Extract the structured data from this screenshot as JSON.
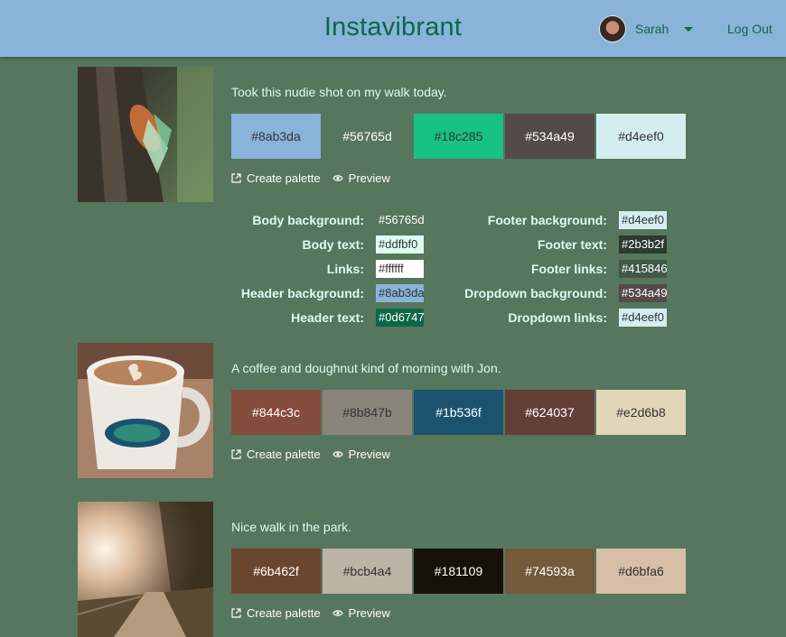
{
  "header": {
    "brand": "Instavibrant",
    "user_name": "Sarah",
    "logout_label": "Log Out",
    "background": "#8ab3da",
    "text_color": "#0d6747"
  },
  "actions": {
    "create_label": "Create palette",
    "preview_label": "Preview"
  },
  "posts": [
    {
      "caption": "Took this nudie shot on my walk today.",
      "photo": "cicada on tree bark",
      "swatches": [
        {
          "hex": "#8ab3da",
          "text": "#333333"
        },
        {
          "hex": "#56765d",
          "text": "#ffffff"
        },
        {
          "hex": "#18c285",
          "text": "#333333"
        },
        {
          "hex": "#534a49",
          "text": "#ffffff"
        },
        {
          "hex": "#d4eef0",
          "text": "#333333"
        }
      ],
      "mapping_left": [
        {
          "label": "Body background:",
          "value": "#56765d",
          "bg": "transparent",
          "fg": "#ffffff"
        },
        {
          "label": "Body text:",
          "value": "#ddfbf0",
          "bg": "#ddfbf0",
          "fg": "#333333"
        },
        {
          "label": "Links:",
          "value": "#ffffff",
          "bg": "#ffffff",
          "fg": "#333333"
        },
        {
          "label": "Header background:",
          "value": "#8ab3da",
          "bg": "#8ab3da",
          "fg": "#333333"
        },
        {
          "label": "Header text:",
          "value": "#0d6747",
          "bg": "#0d6747",
          "fg": "#ffffff"
        }
      ],
      "mapping_right": [
        {
          "label": "Footer background:",
          "value": "#d4eef0",
          "bg": "#d4eef0",
          "fg": "#333333"
        },
        {
          "label": "Footer text:",
          "value": "#2b3b2f",
          "bg": "#2b3b2f",
          "fg": "#ffffff"
        },
        {
          "label": "Footer links:",
          "value": "#415846",
          "bg": "#415846",
          "fg": "#ffffff"
        },
        {
          "label": "Dropdown background:",
          "value": "#534a49",
          "bg": "#534a49",
          "fg": "#ffffff"
        },
        {
          "label": "Dropdown links:",
          "value": "#d4eef0",
          "bg": "#d4eef0",
          "fg": "#333333"
        }
      ]
    },
    {
      "caption": "A coffee and doughnut kind of morning with Jon.",
      "photo": "latte in a mug",
      "swatches": [
        {
          "hex": "#844c3c",
          "text": "#ffffff"
        },
        {
          "hex": "#8b847b",
          "text": "#333333"
        },
        {
          "hex": "#1b536f",
          "text": "#ffffff"
        },
        {
          "hex": "#624037",
          "text": "#ffffff"
        },
        {
          "hex": "#e2d6b8",
          "text": "#333333"
        }
      ]
    },
    {
      "caption": "Nice walk in the park.",
      "photo": "tree-lined path in sunlight",
      "swatches": [
        {
          "hex": "#6b462f",
          "text": "#ffffff"
        },
        {
          "hex": "#bcb4a4",
          "text": "#333333"
        },
        {
          "hex": "#181109",
          "text": "#ffffff"
        },
        {
          "hex": "#74593a",
          "text": "#ffffff"
        },
        {
          "hex": "#d6bfa6",
          "text": "#333333"
        }
      ]
    }
  ]
}
